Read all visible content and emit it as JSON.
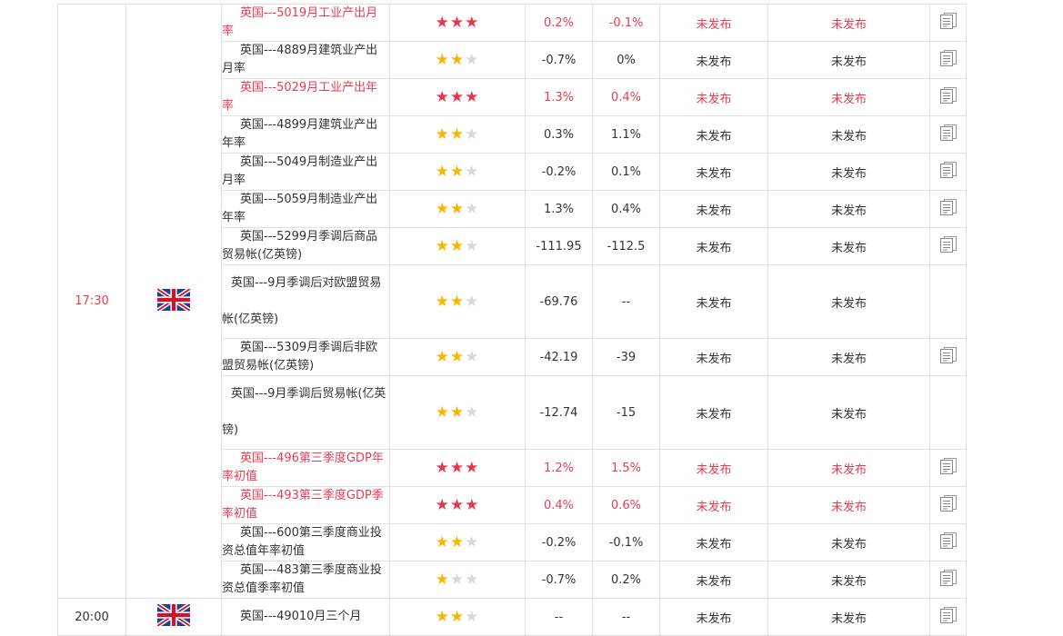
{
  "groups": [
    {
      "time": "17:30",
      "time_highlight": true,
      "flag": "uk-flag-icon",
      "rows": [
        {
          "event": "英国---5019月工业产出月率",
          "stars": 3,
          "prev": "0.2%",
          "forecast": "-0.1%",
          "actual": "未发布",
          "effect": "未发布",
          "hi": true,
          "tall": false,
          "doc": true
        },
        {
          "event": "英国---4889月建筑业产出月率",
          "stars": 2,
          "prev": "-0.7%",
          "forecast": "0%",
          "actual": "未发布",
          "effect": "未发布",
          "hi": false,
          "tall": false,
          "doc": true
        },
        {
          "event": "英国---5029月工业产出年率",
          "stars": 3,
          "prev": "1.3%",
          "forecast": "0.4%",
          "actual": "未发布",
          "effect": "未发布",
          "hi": true,
          "tall": false,
          "doc": true
        },
        {
          "event": "英国---4899月建筑业产出年率",
          "stars": 2,
          "prev": "0.3%",
          "forecast": "1.1%",
          "actual": "未发布",
          "effect": "未发布",
          "hi": false,
          "tall": false,
          "doc": true
        },
        {
          "event": "英国---5049月制造业产出月率",
          "stars": 2,
          "prev": "-0.2%",
          "forecast": "0.1%",
          "actual": "未发布",
          "effect": "未发布",
          "hi": false,
          "tall": false,
          "doc": true
        },
        {
          "event": "英国---5059月制造业产出年率",
          "stars": 2,
          "prev": "1.3%",
          "forecast": "0.4%",
          "actual": "未发布",
          "effect": "未发布",
          "hi": false,
          "tall": false,
          "doc": true
        },
        {
          "event": "英国---5299月季调后商品贸易帐(亿英镑)",
          "stars": 2,
          "prev": "-111.95",
          "forecast": "-112.5",
          "actual": "未发布",
          "effect": "未发布",
          "hi": false,
          "tall": false,
          "doc": true
        },
        {
          "event": "英国---9月季调后对欧盟贸易帐(亿英镑)",
          "stars": 2,
          "prev": "-69.76",
          "forecast": "--",
          "actual": "未发布",
          "effect": "未发布",
          "hi": false,
          "tall": true,
          "doc": false
        },
        {
          "event": "英国---5309月季调后非欧盟贸易帐(亿英镑)",
          "stars": 2,
          "prev": "-42.19",
          "forecast": "-39",
          "actual": "未发布",
          "effect": "未发布",
          "hi": false,
          "tall": false,
          "doc": true
        },
        {
          "event": "英国---9月季调后贸易帐(亿英镑)",
          "stars": 2,
          "prev": "-12.74",
          "forecast": "-15",
          "actual": "未发布",
          "effect": "未发布",
          "hi": false,
          "tall": true,
          "doc": false
        },
        {
          "event": "英国---496第三季度GDP年率初值",
          "stars": 3,
          "prev": "1.2%",
          "forecast": "1.5%",
          "actual": "未发布",
          "effect": "未发布",
          "hi": true,
          "tall": false,
          "doc": true
        },
        {
          "event": "英国---493第三季度GDP季率初值",
          "stars": 3,
          "prev": "0.4%",
          "forecast": "0.6%",
          "actual": "未发布",
          "effect": "未发布",
          "hi": true,
          "tall": false,
          "doc": true
        },
        {
          "event": "英国---600第三季度商业投资总值年率初值",
          "stars": 2,
          "prev": "-0.2%",
          "forecast": "-0.1%",
          "actual": "未发布",
          "effect": "未发布",
          "hi": false,
          "tall": false,
          "doc": true
        },
        {
          "event": "英国---483第三季度商业投资总值季率初值",
          "stars": 1,
          "prev": "-0.7%",
          "forecast": "0.2%",
          "actual": "未发布",
          "effect": "未发布",
          "hi": false,
          "tall": false,
          "doc": true
        }
      ]
    },
    {
      "time": "20:00",
      "time_highlight": false,
      "flag": "uk-flag-icon",
      "rows": [
        {
          "event": "英国---49010月三个月",
          "stars": 2,
          "prev": "--",
          "forecast": "--",
          "actual": "未发布",
          "effect": "未发布",
          "hi": false,
          "tall": false,
          "doc": true
        }
      ]
    }
  ],
  "colors": {
    "highlight": "#e73c53",
    "star_gold": "#f5b700",
    "star_red": "#e7374f",
    "star_empty": "#d8d8d8",
    "border": "#e0e0e0"
  },
  "icons": {
    "star": "star-icon",
    "doc": "document-icon",
    "flag": "uk-flag-icon"
  }
}
